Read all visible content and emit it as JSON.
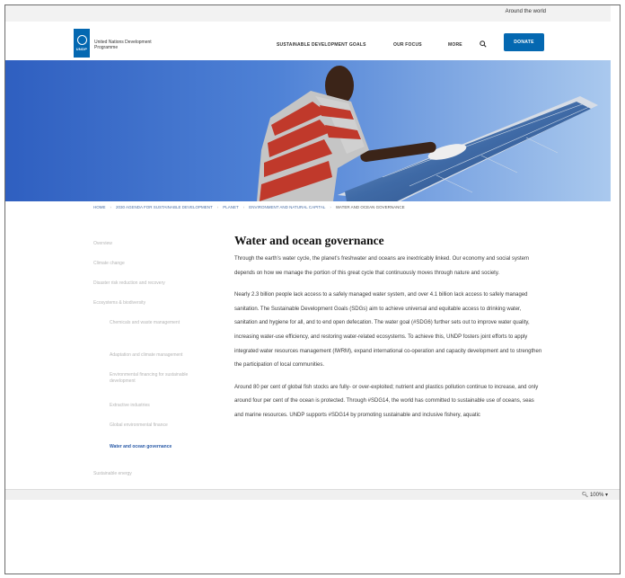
{
  "utility_bar": {
    "around_world_label": "Around the world"
  },
  "header": {
    "logo_letters": "UNDP",
    "logo_text": "United Nations Development Programme",
    "nav": [
      "SUSTAINABLE DEVELOPMENT GOALS",
      "OUR FOCUS",
      "MORE"
    ],
    "donate_label": "DONATE"
  },
  "breadcrumb": [
    "HOME",
    "2030 AGENDA FOR SUSTAINABLE DEVELOPMENT",
    "PLANET",
    "ENVIRONMENT AND NATURAL CAPITAL",
    "WATER AND OCEAN GOVERNANCE"
  ],
  "sidebar": {
    "items": [
      "Overview",
      "Climate change",
      "Disaster risk reduction and recovery",
      "Ecosystems & biodiversity",
      "Chemicals and waste management",
      "Adaptation and climate management",
      "Environmental financing for sustainable development",
      "Extractive industries",
      "Global environmental finance",
      "Water and ocean governance",
      "Sustainable energy"
    ],
    "active_index": 9
  },
  "main": {
    "title": "Water and ocean governance",
    "paragraphs": [
      "Through the earth’s water cycle, the planet’s freshwater and oceans are inextricably linked. Our economy and social system depends on how we manage the portion of this great cycle that continuously moves through nature and society.",
      "Nearly 2.3 billion people lack access to a safely managed water system, and over 4.1 billion lack access to safely managed sanitation. The Sustainable Development Goals (SDGs) aim to achieve universal and equitable access to drinking water, sanitation and hygiene for all, and to end open defecation. The water goal (#SDG6) further sets out to improve water quality, increasing water-use efficiency, and restoring water-related ecosystems. To achieve this, UNDP fosters joint efforts to apply integrated water resources management (IWRM), expand international co-operation and capacity development and to strengthen the participation of local communities.",
      "Around 80 per cent of global fish stocks are fully- or over-exploited; nutrient and plastics pollution continue to increase, and only around four per cent of the ocean is protected. Through #SDG14, the world has committed to sustainable use of oceans, seas and marine resources. UNDP supports #SDG14 by promoting sustainable and inclusive fishery, aquatic"
    ]
  },
  "browser": {
    "zoom_label": "100%"
  },
  "colors": {
    "brand_blue": "#0468b1",
    "active_link": "#2a5ba8"
  }
}
